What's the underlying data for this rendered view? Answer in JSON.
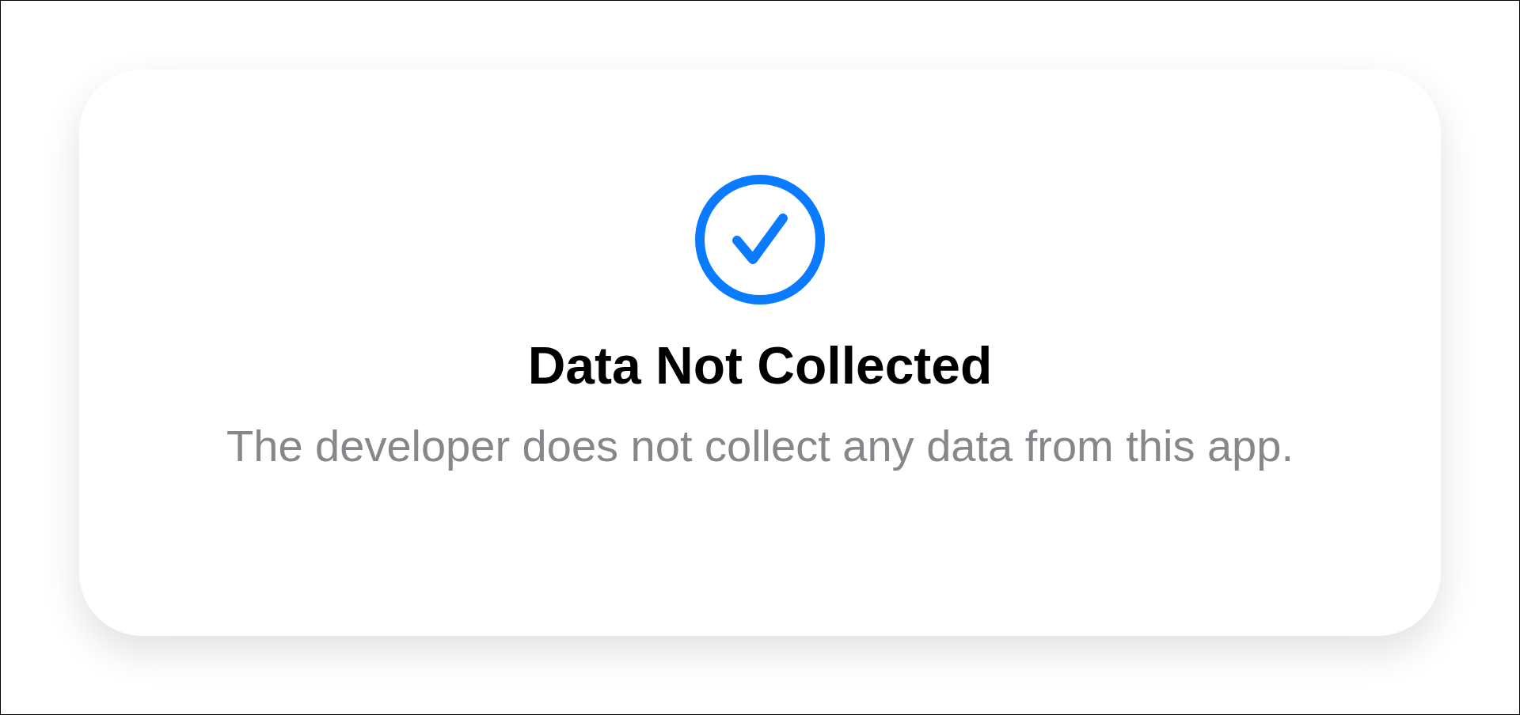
{
  "card": {
    "title": "Data Not Collected",
    "description": "The developer does not collect any data from this app."
  }
}
